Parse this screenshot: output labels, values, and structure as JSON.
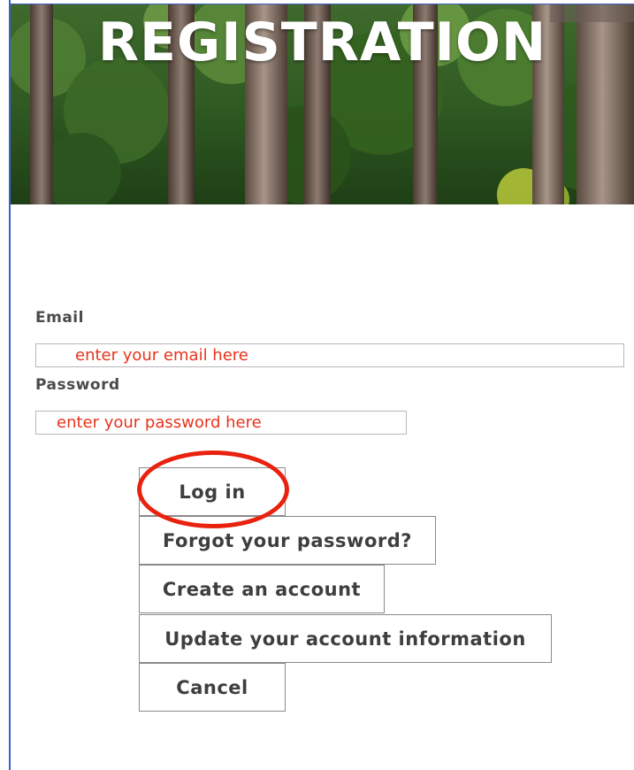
{
  "banner": {
    "title": "REGISTRATION"
  },
  "form": {
    "email_label": "Email",
    "email_placeholder": "enter your email here",
    "password_label": "Password",
    "password_placeholder": "enter your password here"
  },
  "buttons": {
    "login": "Log in",
    "forgot": "Forgot your password?",
    "create": "Create an account",
    "update": "Update your account information",
    "cancel": "Cancel"
  },
  "colors": {
    "placeholder_text": "#e8341c",
    "highlight": "#e8220f",
    "frame_border": "#3a63c4"
  }
}
